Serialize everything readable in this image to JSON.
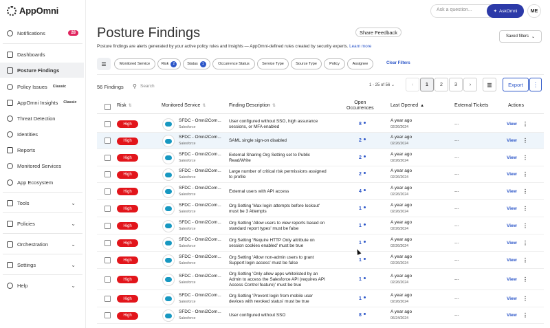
{
  "brand": {
    "name": "AppOmni"
  },
  "top": {
    "ask_placeholder": "Ask a question...",
    "askomni_label": "AskOmni",
    "avatar_initials": "ME"
  },
  "sidebar": {
    "items": [
      {
        "label": "Notifications",
        "badge": "28"
      },
      {
        "label": "Dashboards"
      },
      {
        "label": "Posture Findings"
      },
      {
        "label": "Policy Issues",
        "tag": "Classic"
      },
      {
        "label": "AppOmni Insights",
        "tag": "Classic"
      },
      {
        "label": "Threat Detection"
      },
      {
        "label": "Identities"
      },
      {
        "label": "Reports"
      },
      {
        "label": "Monitored Services"
      },
      {
        "label": "App Ecosystem"
      },
      {
        "label": "Tools"
      },
      {
        "label": "Policies"
      },
      {
        "label": "Orchestration"
      },
      {
        "label": "Settings"
      },
      {
        "label": "Help"
      }
    ]
  },
  "header": {
    "title": "Posture Findings",
    "share_label": "Share Feedback",
    "saved_filters_label": "Saved filters",
    "subtitle": "Posture findings are alerts generated by your active policy rules and Insights — AppOmni-defined rules created by security experts.",
    "learn_more": "Learn more"
  },
  "filters": {
    "chips": [
      {
        "label": "Monitored Service"
      },
      {
        "label": "Risk",
        "count": "2"
      },
      {
        "label": "Status",
        "count": "1"
      },
      {
        "label": "Occurrence Status"
      },
      {
        "label": "Service Type"
      },
      {
        "label": "Source Type"
      },
      {
        "label": "Policy"
      },
      {
        "label": "Assignee"
      }
    ],
    "clear_label": "Clear Filters"
  },
  "toolbar": {
    "count_label": "56 Findings",
    "search_placeholder": "Search",
    "range_label": "1 - 25 of 56",
    "pages": [
      "1",
      "2",
      "3"
    ],
    "export_label": "Export"
  },
  "table": {
    "headers": {
      "risk": "Risk",
      "service": "Monitored Service",
      "description": "Finding Description",
      "occurrences_1": "Open",
      "occurrences_2": "Occurrences",
      "last_opened": "Last Opened",
      "external": "External Tickets",
      "actions": "Actions"
    },
    "rows": [
      {
        "risk": "High",
        "service": "SFDC - Omni2Com...",
        "service_type": "Salesforce",
        "desc": [
          "User configured without SSO, high assurance",
          "sessions, or MFA enabled"
        ],
        "occ": "8",
        "last": "A year ago",
        "date": "02/26/2024",
        "ext": "---",
        "action": "View"
      },
      {
        "risk": "High",
        "service": "SFDC - Omni2Com...",
        "service_type": "Salesforce",
        "desc": [
          "SAML single sign-on disabled"
        ],
        "occ": "2",
        "last": "A year ago",
        "date": "02/26/2024",
        "ext": "---",
        "action": "View"
      },
      {
        "risk": "High",
        "service": "SFDC - Omni2Com...",
        "service_type": "Salesforce",
        "desc": [
          "External Sharing Org Setting set to Public",
          "Read/Write"
        ],
        "occ": "2",
        "last": "A year ago",
        "date": "02/26/2024",
        "ext": "---",
        "action": "View"
      },
      {
        "risk": "High",
        "service": "SFDC - Omni2Com...",
        "service_type": "Salesforce",
        "desc": [
          "Large number of critical risk permissions assigned",
          "to profile"
        ],
        "occ": "2",
        "last": "A year ago",
        "date": "02/26/2024",
        "ext": "---",
        "action": "View"
      },
      {
        "risk": "High",
        "service": "SFDC - Omni2Com...",
        "service_type": "Salesforce",
        "desc": [
          "External users with API access"
        ],
        "occ": "4",
        "last": "A year ago",
        "date": "02/26/2024",
        "ext": "---",
        "action": "View"
      },
      {
        "risk": "High",
        "service": "SFDC - Omni2Com...",
        "service_type": "Salesforce",
        "desc": [
          "Org Setting 'Max login attempts before lockout'",
          "must be 3 Attempts"
        ],
        "occ": "1",
        "last": "A year ago",
        "date": "02/26/2024",
        "ext": "---",
        "action": "View"
      },
      {
        "risk": "High",
        "service": "SFDC - Omni2Com...",
        "service_type": "Salesforce",
        "desc": [
          "Org Setting 'Allow users to view reports based on",
          "standard report types' must be false"
        ],
        "occ": "1",
        "last": "A year ago",
        "date": "02/26/2024",
        "ext": "---",
        "action": "View"
      },
      {
        "risk": "High",
        "service": "SFDC - Omni2Com...",
        "service_type": "Salesforce",
        "desc": [
          "Org Setting 'Require HTTP Only attribute on",
          "session cookies enabled' must be true"
        ],
        "occ": "1",
        "last": "A year ago",
        "date": "02/26/2024",
        "ext": "---",
        "action": "View"
      },
      {
        "risk": "High",
        "service": "SFDC - Omni2Com...",
        "service_type": "Salesforce",
        "desc": [
          "Org Setting 'Allow non-admin users to grant",
          "Support login access' must be false"
        ],
        "occ": "1",
        "last": "A year ago",
        "date": "02/26/2024",
        "ext": "---",
        "action": "View"
      },
      {
        "risk": "High",
        "service": "SFDC - Omni2Com...",
        "service_type": "Salesforce",
        "desc": [
          "Org Setting 'Only allow apps whitelisted by an",
          "Admin to access the Salesforce API (requires API",
          "Access Control feature)' must be true"
        ],
        "occ": "1",
        "last": "A year ago",
        "date": "02/26/2024",
        "ext": "---",
        "action": "View"
      },
      {
        "risk": "High",
        "service": "SFDC - Omni2Com...",
        "service_type": "Salesforce",
        "desc": [
          "Org Setting 'Prevent login from mobile user",
          "devices with revoked status' must be true"
        ],
        "occ": "1",
        "last": "A year ago",
        "date": "02/26/2024",
        "ext": "---",
        "action": "View"
      },
      {
        "risk": "High",
        "service": "SFDC - Omni2Com...",
        "service_type": "Salesforce",
        "desc": [
          "User configured without SSO"
        ],
        "occ": "8",
        "last": "A year ago",
        "date": "06/24/2024",
        "ext": "---",
        "action": "View"
      }
    ]
  }
}
